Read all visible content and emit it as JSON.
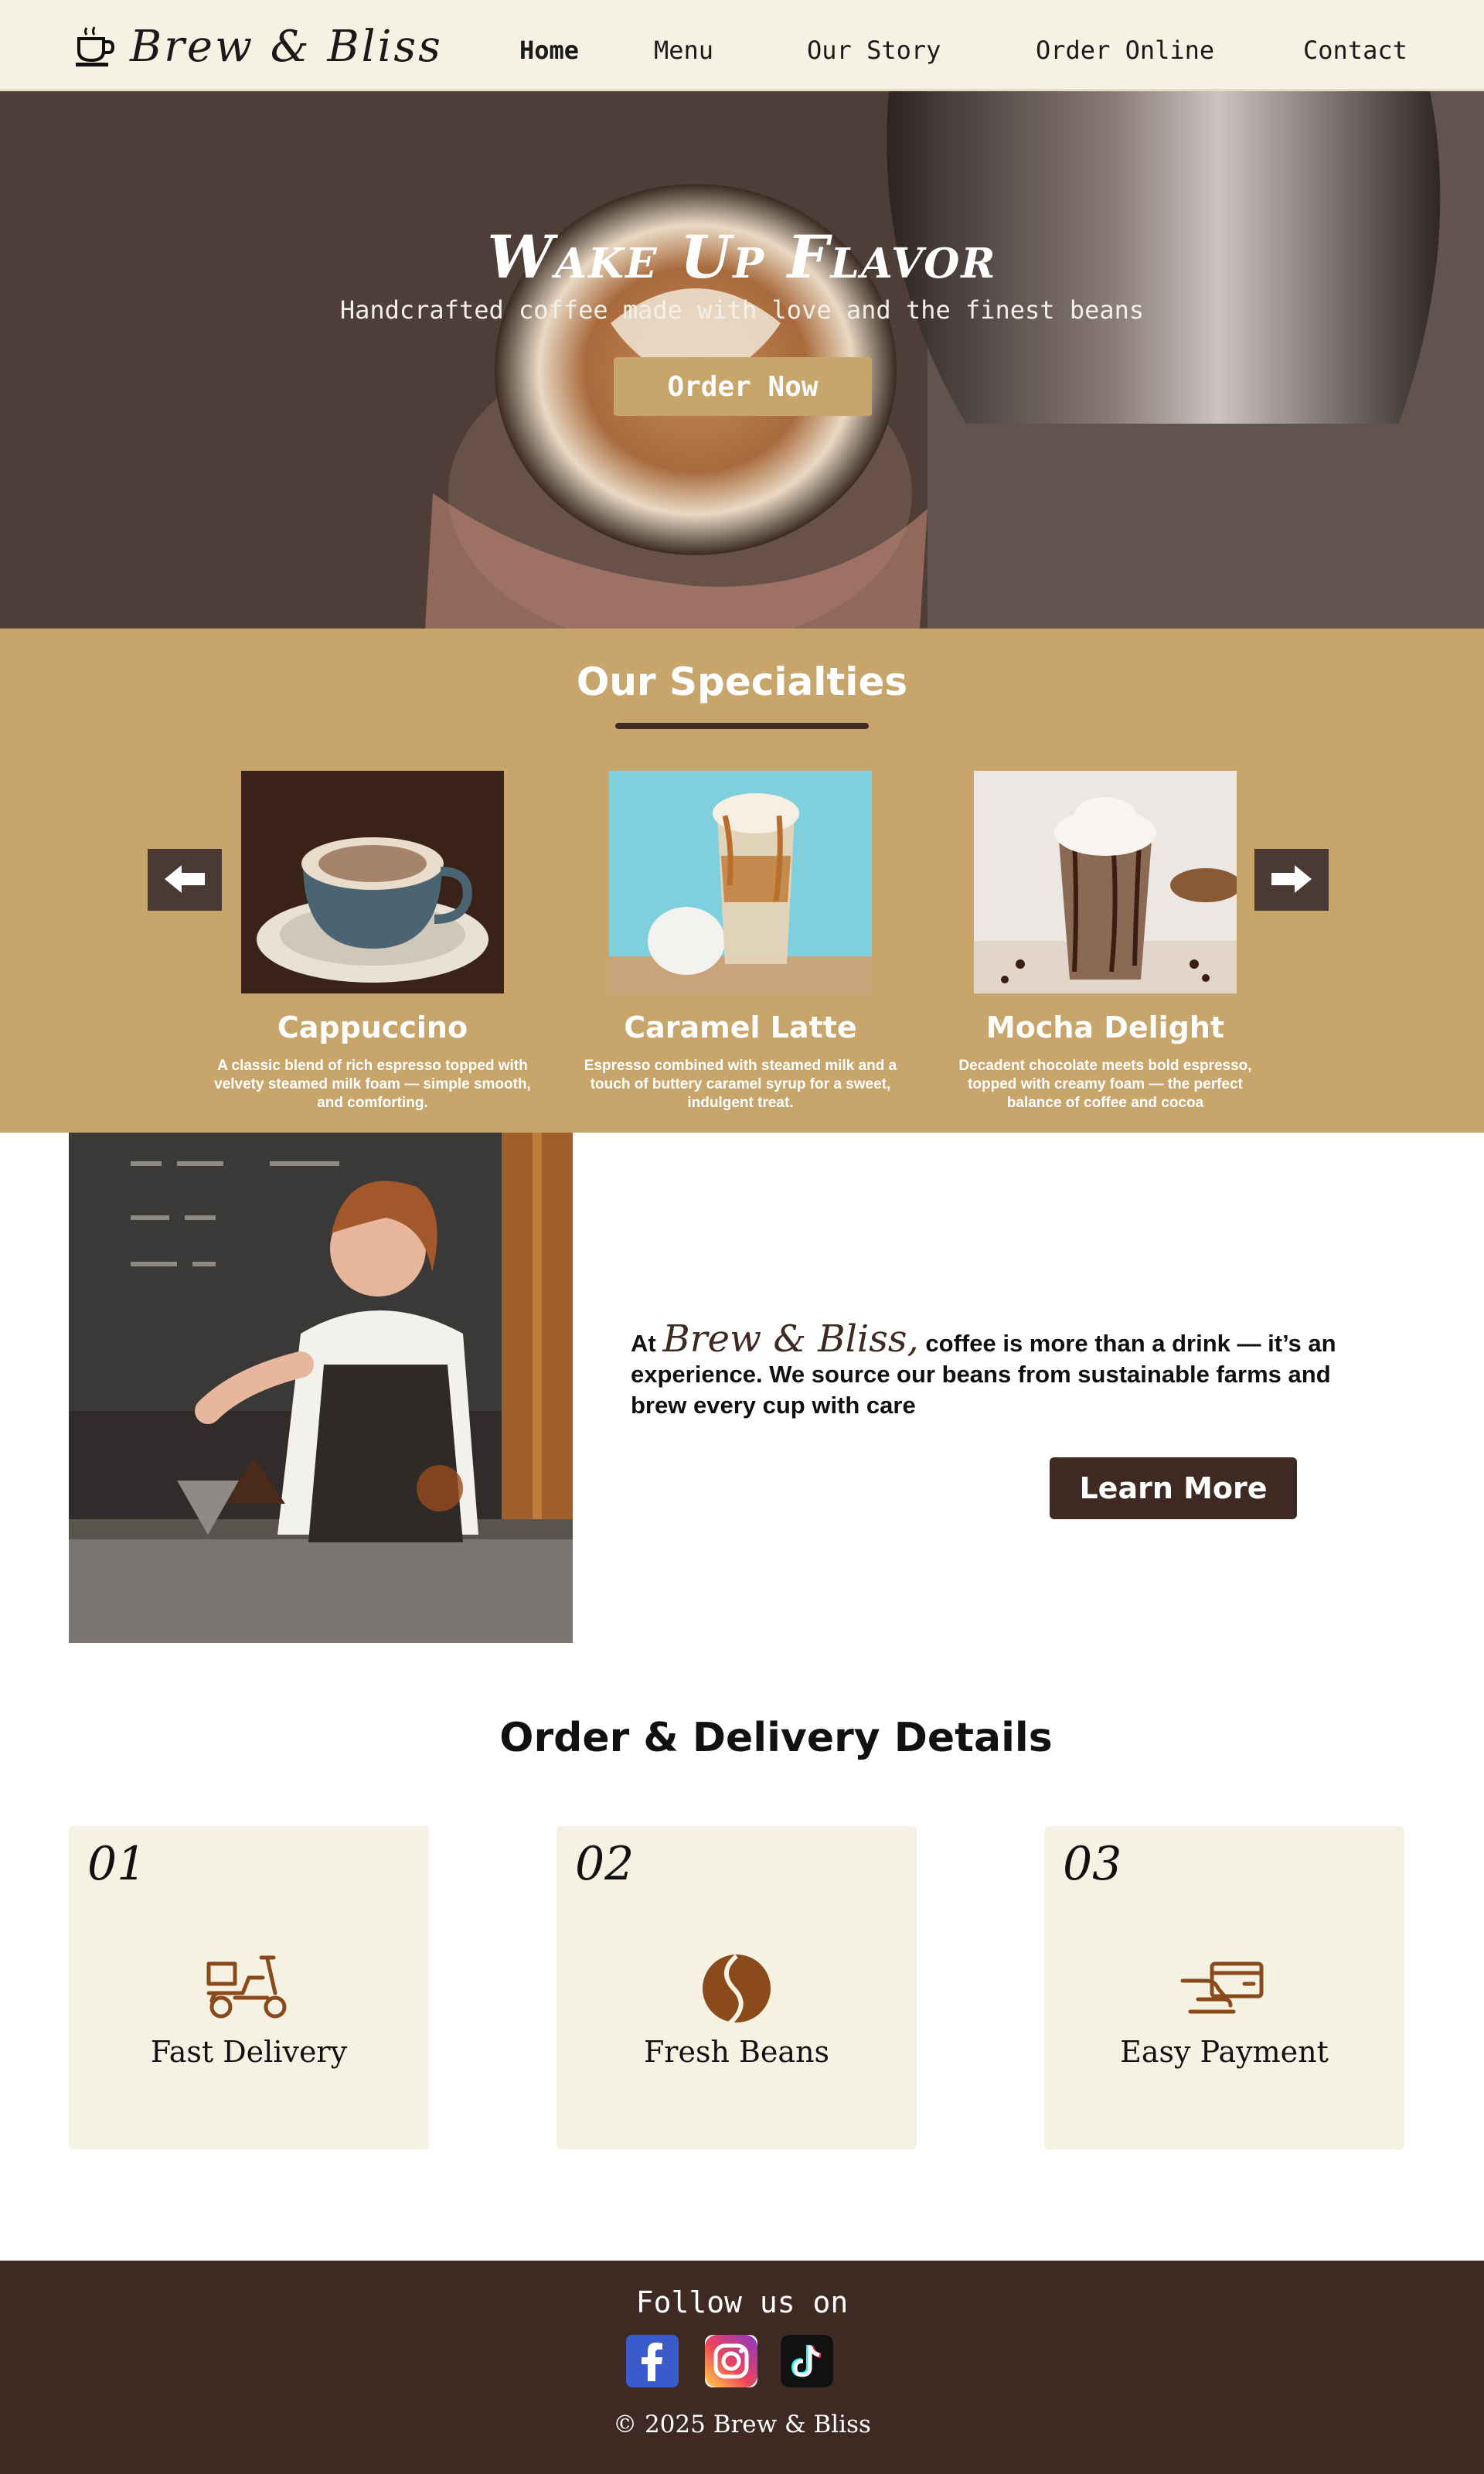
{
  "nav": {
    "brand": "Brew & Bliss",
    "brand_icon": "coffee-cup-icon",
    "links": [
      "Home",
      "Menu",
      "Our Story",
      "Order Online",
      "Contact"
    ],
    "active": "Home"
  },
  "hero": {
    "title": "Wake Up Flavor",
    "subtitle": "Handcrafted coffee made with love and the finest beans",
    "button": "Order Now"
  },
  "specialties": {
    "title": "Our Specialties",
    "prev_icon": "arrow-left-icon",
    "next_icon": "arrow-right-icon",
    "items": [
      {
        "name": "Cappuccino",
        "desc": "A classic blend of rich espresso topped with velvety steamed milk foam — simple smooth, and comforting."
      },
      {
        "name": "Caramel Latte",
        "desc": "Espresso combined with steamed milk and a touch of buttery caramel syrup for a sweet, indulgent treat."
      },
      {
        "name": "Mocha Delight",
        "desc": "Decadent chocolate meets bold espresso, topped with creamy foam — the perfect balance of coffee and cocoa"
      }
    ]
  },
  "about": {
    "prefix": "At",
    "brand": "Brew & Bliss,",
    "text": "coffee is more than a drink — it’s an experience. We source our beans from sustainable farms and brew every cup with care",
    "button": "Learn More"
  },
  "order": {
    "title": "Order & Delivery Details",
    "items": [
      {
        "num": "01",
        "label": "Fast Delivery",
        "icon": "scooter-icon"
      },
      {
        "num": "02",
        "label": "Fresh Beans",
        "icon": "coffee-bean-icon"
      },
      {
        "num": "03",
        "label": "Easy Payment",
        "icon": "card-payment-icon"
      }
    ]
  },
  "footer": {
    "follow": "Follow us on",
    "socials": [
      "facebook-icon",
      "instagram-icon",
      "tiktok-icon"
    ],
    "copyright": "© 2025 Brew & Bliss"
  },
  "colors": {
    "cream": "#f6f2e3",
    "gold": "#c8a56b",
    "dark_brown": "#3e2a22",
    "icon_brown": "#8b4a1c"
  }
}
